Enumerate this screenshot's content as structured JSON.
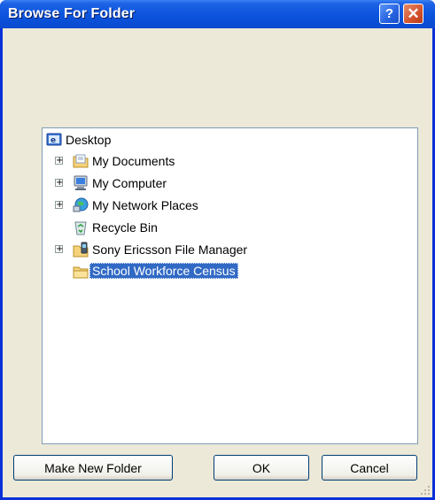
{
  "window": {
    "title": "Browse For Folder",
    "help_label": "?",
    "close_label": "✕"
  },
  "tree": {
    "items": [
      {
        "label": "Desktop",
        "icon": "desktop-icon",
        "expander": ""
      },
      {
        "label": "My Documents",
        "icon": "my-documents-icon",
        "expander": "+"
      },
      {
        "label": "My Computer",
        "icon": "my-computer-icon",
        "expander": "+"
      },
      {
        "label": "My Network Places",
        "icon": "network-places-icon",
        "expander": "+"
      },
      {
        "label": "Recycle Bin",
        "icon": "recycle-bin-icon",
        "expander": ""
      },
      {
        "label": "Sony Ericsson File Manager",
        "icon": "file-manager-icon",
        "expander": "+"
      },
      {
        "label": "School Workforce Census",
        "icon": "folder-icon",
        "expander": "",
        "selected": true
      }
    ]
  },
  "buttons": {
    "make_new_folder": "Make New Folder",
    "ok": "OK",
    "cancel": "Cancel"
  },
  "colors": {
    "titlebar": "#0a50d8",
    "dialog_bg": "#ece9d8",
    "selection": "#316ac5",
    "close": "#d3532c"
  }
}
